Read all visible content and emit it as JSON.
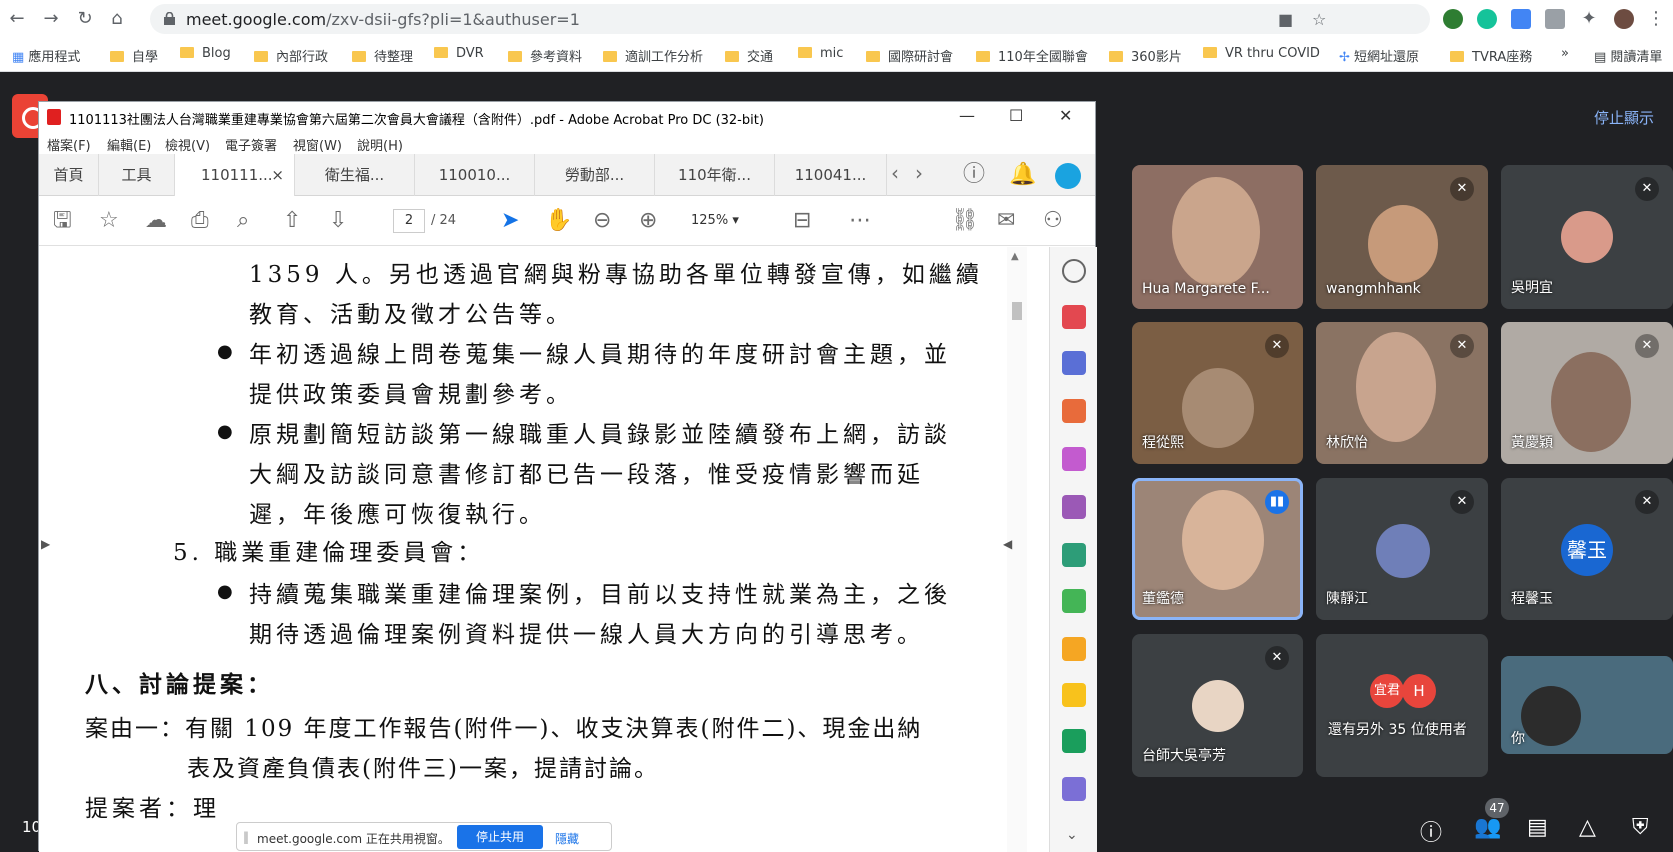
{
  "browser": {
    "url_host": "meet.google.com",
    "url_path": "/zxv-dsii-gfs?pli=1&authuser=1",
    "bookmarks": [
      "應用程式",
      "自學",
      "Blog",
      "內部行政",
      "待整理",
      "DVR",
      "參考資料",
      "適訓工作分析",
      "交通",
      "mic",
      "國際研討會",
      "110年全國聯會",
      "360影片",
      "VR thru COVID",
      "短網址還原",
      "TVRA座務",
      "閱讀清單"
    ]
  },
  "meet": {
    "stop_presenting": "停止顯示",
    "participant_count": "47",
    "left_number": "10",
    "participants": [
      {
        "name": "Hua Margarete F...",
        "muted": false
      },
      {
        "name": "wangmhhank",
        "muted": true
      },
      {
        "name": "吳明宜",
        "muted": true
      },
      {
        "name": "程從熙",
        "muted": true
      },
      {
        "name": "林欣怡",
        "muted": true
      },
      {
        "name": "黃慶穎",
        "muted": true
      },
      {
        "name": "董鑑德",
        "muted": false,
        "speaking": true
      },
      {
        "name": "陳靜江",
        "muted": true
      },
      {
        "name": "程馨玉",
        "muted": true,
        "avatar_text": "馨玉"
      },
      {
        "name": "台師大吳亭芳",
        "muted": true
      },
      {
        "name": "還有另外 35 位使用者",
        "muted": false,
        "avatar_text_1": "宜君",
        "avatar_text_2": "H"
      },
      {
        "name": "你",
        "muted": false
      }
    ],
    "share_notice": "meet.google.com 正在共用視窗。",
    "share_stop": "停止共用",
    "share_hide": "隱藏"
  },
  "acrobat": {
    "title": "1101113社團法人台灣職業重建專業協會第六屆第二次會員大會議程（含附件）.pdf - Adobe Acrobat Pro DC (32-bit)",
    "menu": [
      "檔案(F)",
      "編輯(E)",
      "檢視(V)",
      "電子簽署",
      "視窗(W)",
      "說明(H)"
    ],
    "tabs": [
      "首頁",
      "工具",
      "110111...",
      "衛生福...",
      "110010...",
      "勞動部...",
      "110年衛...",
      "110041..."
    ],
    "page_current": "2",
    "page_total": "/ 24",
    "zoom": "125%"
  },
  "document": {
    "lines": [
      "1359 人。另也透過官網與粉專協助各單位轉發宣傳，如繼續",
      "教育、活動及徵才公告等。",
      "年初透過線上問卷蒐集一線人員期待的年度研討會主題，並",
      "提供政策委員會規劃參考。",
      "原規劃簡短訪談第一線職重人員錄影並陸續發布上網，訪談",
      "大綱及訪談同意書修訂都已告一段落，惟受疫情影響而延",
      "遲，年後應可恢復執行。",
      "5. 職業重建倫理委員會：",
      "持續蒐集職業重建倫理案例，目前以支持性就業為主，之後",
      "期待透過倫理案例資料提供一線人員大方向的引導思考。",
      "八、討論提案：",
      "案由一：有關 109 年度工作報告(附件一)、收支決算表(附件二)、現金出納",
      "表及資產負債表(附件三)一案，提請討論。",
      "提案者：理"
    ]
  }
}
